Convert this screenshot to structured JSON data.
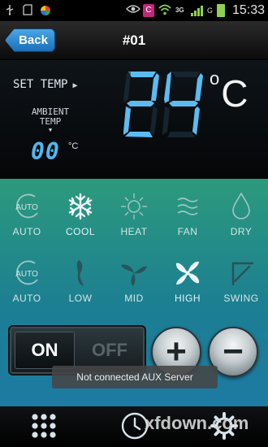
{
  "status_bar": {
    "time": "15:33",
    "network_label": "3G",
    "network_sub": "G",
    "icons": [
      "usb-icon",
      "sd-card-icon",
      "app-icon",
      "eye-icon",
      "notification-icon",
      "wifi-icon",
      "signal-icon",
      "battery-icon"
    ]
  },
  "header": {
    "back_label": "Back",
    "title": "#01"
  },
  "temperature": {
    "set_label": "SET TEMP",
    "set_value": "24",
    "set_unit": "°C",
    "ambient_label_1": "AMBIENT",
    "ambient_label_2": "TEMP",
    "ambient_value": "00",
    "ambient_unit": "°C"
  },
  "modes": [
    {
      "label": "AUTO",
      "icon": "auto-icon",
      "active": false
    },
    {
      "label": "COOL",
      "icon": "snowflake-icon",
      "active": true
    },
    {
      "label": "HEAT",
      "icon": "sun-icon",
      "active": false
    },
    {
      "label": "FAN",
      "icon": "waves-icon",
      "active": false
    },
    {
      "label": "DRY",
      "icon": "droplet-icon",
      "active": false
    }
  ],
  "fan_speeds": [
    {
      "label": "AUTO",
      "icon": "auto-icon",
      "active": false
    },
    {
      "label": "LOW",
      "icon": "fan-low-icon",
      "active": false
    },
    {
      "label": "MID",
      "icon": "fan-mid-icon",
      "active": false
    },
    {
      "label": "HIGH",
      "icon": "fan-high-icon",
      "active": true
    },
    {
      "label": "SWING",
      "icon": "swing-icon",
      "active": false
    }
  ],
  "power": {
    "on_label": "ON",
    "off_label": "OFF",
    "state": "on"
  },
  "controls": {
    "plus_label": "+",
    "minus_label": "−"
  },
  "toast": "Not connected AUX Server",
  "watermark": "xfdown.com",
  "colors": {
    "accent_blue": "#4fb8ef",
    "panel_green": "#2c9a7c",
    "panel_blue": "#1d7aa3"
  }
}
